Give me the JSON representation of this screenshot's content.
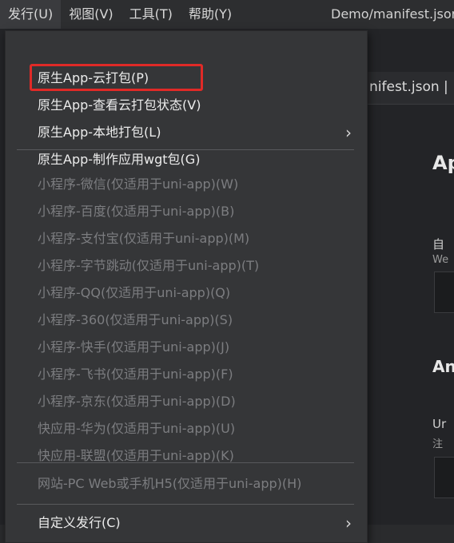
{
  "menubar": {
    "items": [
      "发行(U)",
      "视图(V)",
      "工具(T)",
      "帮助(Y)"
    ],
    "window_title": "Demo/manifest.json"
  },
  "editor": {
    "tab_label": "nifest.json |",
    "heading_ap": "Ap",
    "heading_an": "An",
    "label_zi": "自",
    "label_we": "We",
    "label_ur": "Ur",
    "label_zhu": "注"
  },
  "dropdown": {
    "group1": [
      "原生App-云打包(P)",
      "原生App-查看云打包状态(V)",
      "原生App-本地打包(L)",
      "原生App-制作应用wgt包(G)"
    ],
    "group2": [
      "小程序-微信(仅适用于uni-app)(W)",
      "小程序-百度(仅适用于uni-app)(B)",
      "小程序-支付宝(仅适用于uni-app)(M)",
      "小程序-字节跳动(仅适用于uni-app)(T)",
      "小程序-QQ(仅适用于uni-app)(Q)",
      "小程序-360(仅适用于uni-app)(S)",
      "小程序-快手(仅适用于uni-app)(J)",
      "小程序-飞书(仅适用于uni-app)(F)",
      "小程序-京东(仅适用于uni-app)(D)",
      "快应用-华为(仅适用于uni-app)(U)",
      "快应用-联盟(仅适用于uni-app)(K)"
    ],
    "group3": [
      "网站-PC Web或手机H5(仅适用于uni-app)(H)"
    ],
    "group4": [
      "自定义发行(C)"
    ]
  },
  "colors": {
    "highlight_border": "#e02a27",
    "menu_bg": "#353638",
    "disabled_text": "#7c7d80"
  }
}
